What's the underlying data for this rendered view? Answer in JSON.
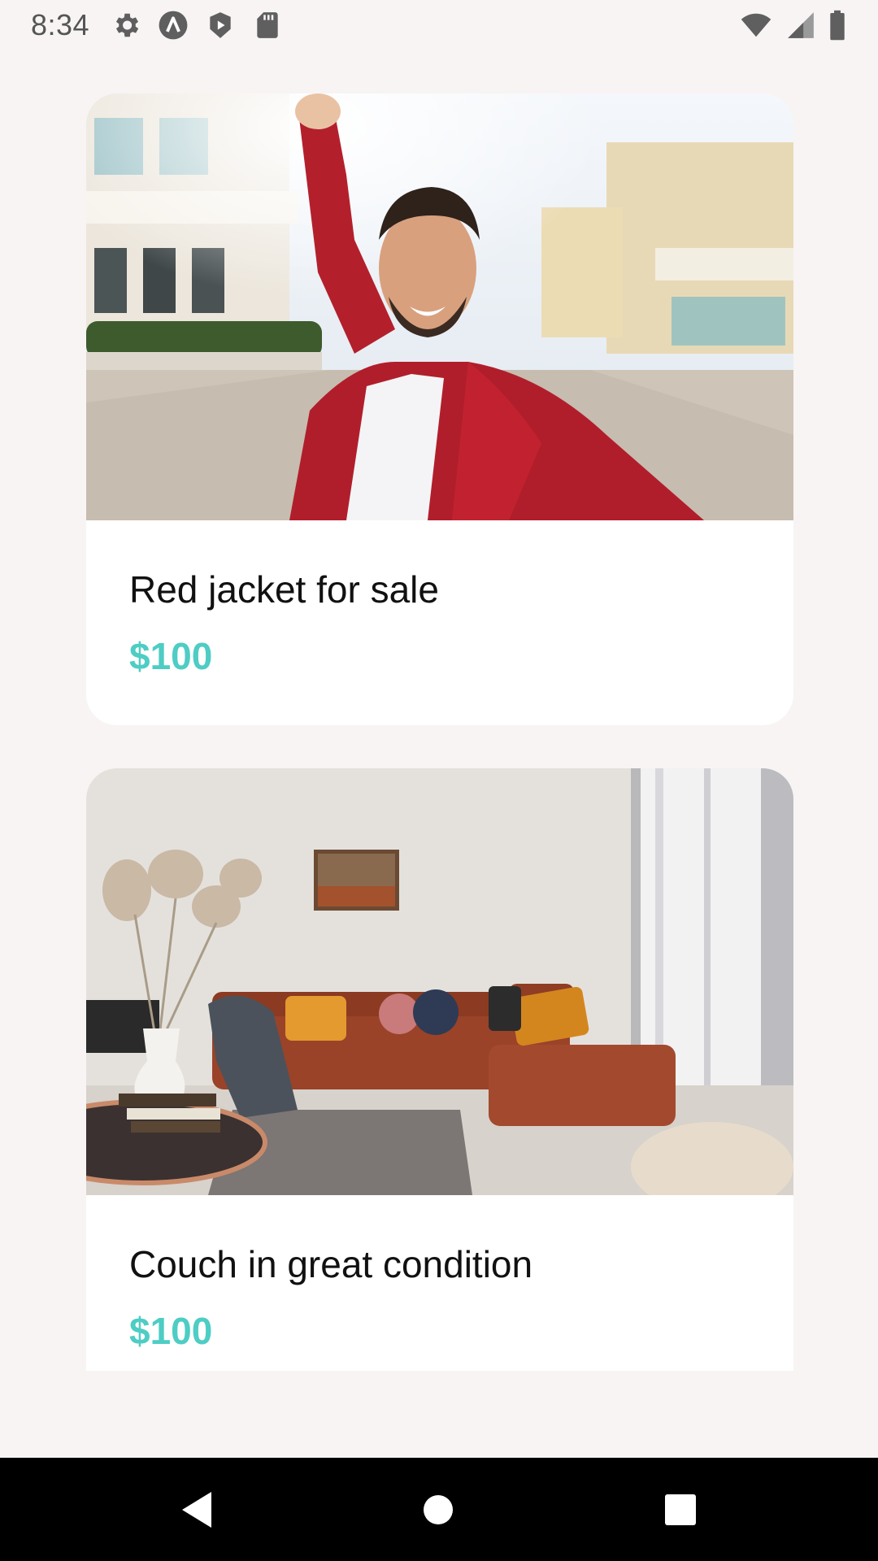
{
  "status_bar": {
    "time": "8:34",
    "left_icons": [
      "settings-icon",
      "app-a-icon",
      "play-store-icon",
      "sd-card-icon"
    ],
    "right_icons": [
      "wifi-icon",
      "cell-signal-icon",
      "battery-icon"
    ]
  },
  "listings": [
    {
      "title": "Red jacket for sale",
      "price": "$100",
      "image": "man-in-red-jacket-selfie"
    },
    {
      "title": "Couch in great condition",
      "price": "$100",
      "image": "living-room-orange-couch"
    }
  ],
  "colors": {
    "background": "#f8f4f4",
    "card": "#ffffff",
    "price": "#4ecdc4",
    "title": "#111111",
    "nav_bar": "#000000"
  },
  "nav_bar": {
    "buttons": [
      "back-icon",
      "home-icon",
      "recents-icon"
    ]
  }
}
